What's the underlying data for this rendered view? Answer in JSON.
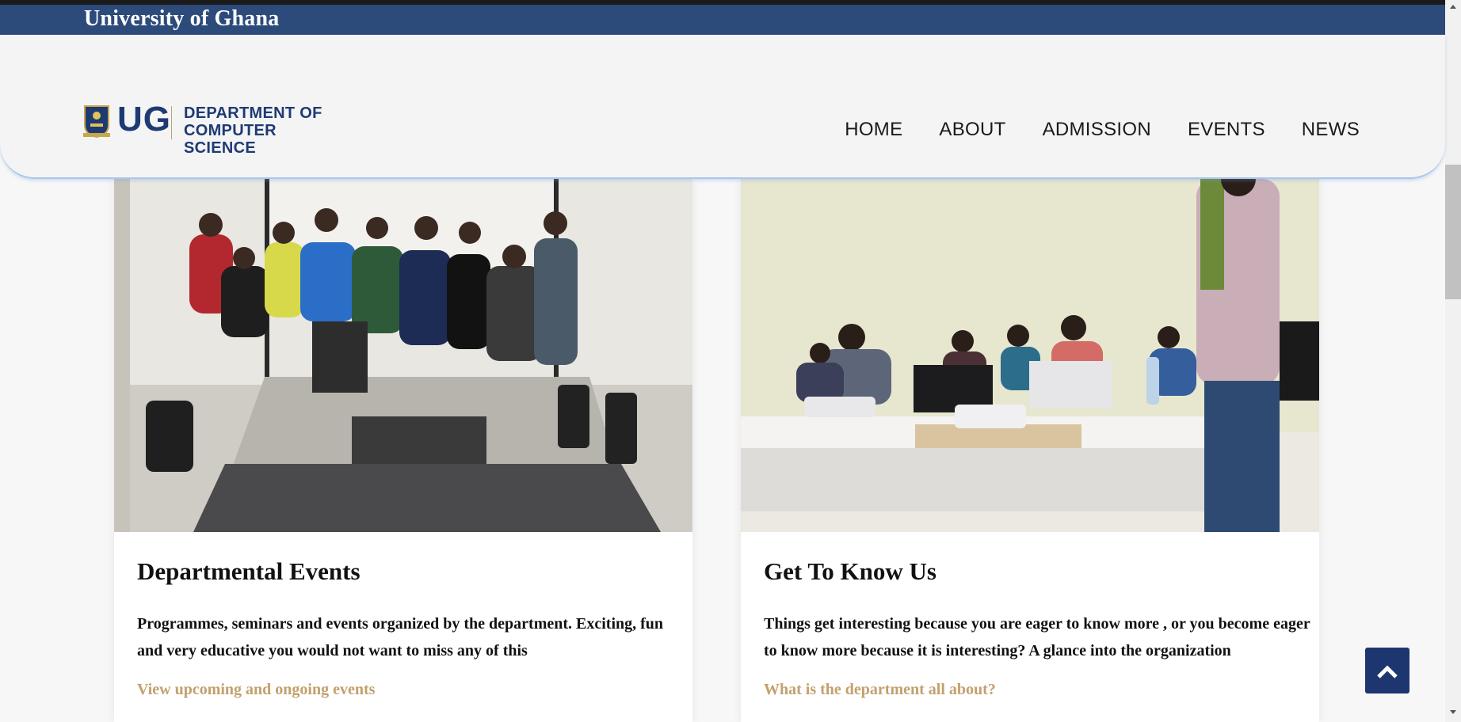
{
  "topbar": {
    "title": "University of Ghana"
  },
  "brand": {
    "short": "UG",
    "line1": "DEPARTMENT OF",
    "line2": "COMPUTER SCIENCE",
    "crest_icon": "university-crest-icon"
  },
  "nav": {
    "items": [
      {
        "label": "HOME"
      },
      {
        "label": "ABOUT"
      },
      {
        "label": "ADMISSION"
      },
      {
        "label": "EVENTS"
      },
      {
        "label": "NEWS"
      }
    ]
  },
  "cards": [
    {
      "title": "Departmental Events",
      "text": "Programmes, seminars and events organized by the department. Exciting, fun and very educative you would not want to miss any of this",
      "link": "View upcoming and ongoing events"
    },
    {
      "title": "Get To Know Us",
      "text": "Things get interesting because you are eager to know more , or you become eager to know more because it is interesting? A glance into the organization",
      "link": "What is the department all about?"
    }
  ],
  "back_to_top": {
    "icon": "chevron-up-icon"
  },
  "colors": {
    "topbar_bg": "#2c4a7a",
    "brand": "#1e3a73",
    "link": "#c3a06d",
    "back_to_top_bg": "#1e3670"
  }
}
